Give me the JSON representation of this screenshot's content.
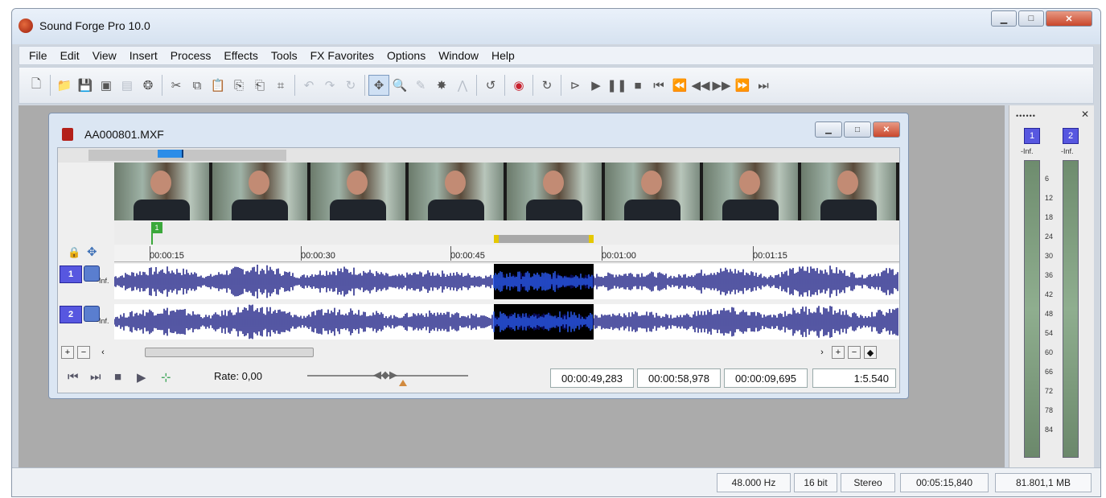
{
  "window": {
    "title": "Sound Forge Pro 10.0"
  },
  "menu": [
    "File",
    "Edit",
    "View",
    "Insert",
    "Process",
    "Effects",
    "Tools",
    "FX Favorites",
    "Options",
    "Window",
    "Help"
  ],
  "document": {
    "title": "AA000801.MXF",
    "marker_label": "1",
    "ruler_ticks": [
      "00:00:15",
      "00:00:30",
      "00:00:45",
      "00:01:00",
      "00:01:15"
    ],
    "channels": [
      {
        "badge": "1",
        "level": "-Inf."
      },
      {
        "badge": "2",
        "level": "-Inf."
      }
    ],
    "rate_label": "Rate: 0,00",
    "selection_start": "00:00:49,283",
    "selection_end": "00:00:58,978",
    "selection_length": "00:00:09,695",
    "zoom": "1:5.540"
  },
  "meter": {
    "header": "••••••",
    "channels": [
      {
        "badge": "1",
        "peak": "-Inf."
      },
      {
        "badge": "2",
        "peak": "-Inf."
      }
    ],
    "scale": [
      "6",
      "12",
      "18",
      "24",
      "30",
      "36",
      "42",
      "48",
      "54",
      "60",
      "66",
      "72",
      "78",
      "84"
    ]
  },
  "status": {
    "sample_rate": "48.000 Hz",
    "bit_depth": "16 bit",
    "channels": "Stereo",
    "length": "00:05:15,840",
    "disk_space": "81.801,1 MB"
  }
}
